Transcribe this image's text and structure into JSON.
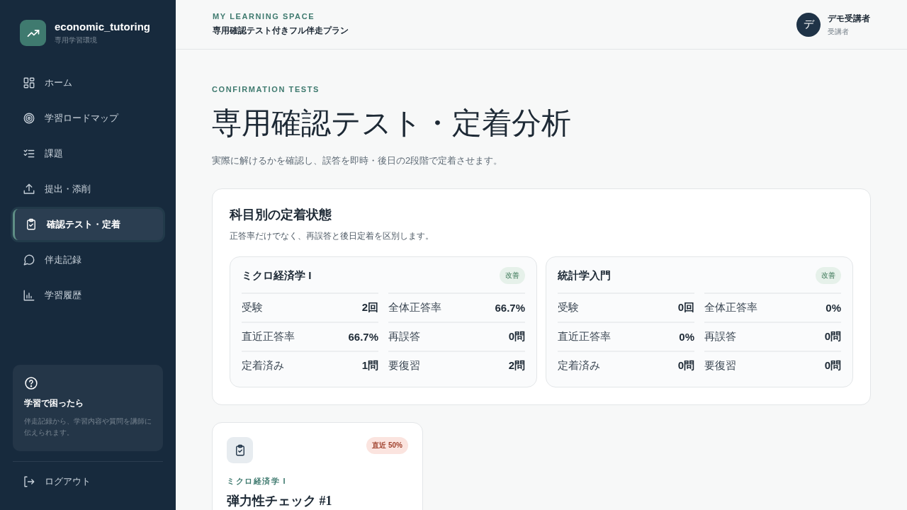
{
  "sidebar": {
    "brand": {
      "name": "economic_tutoring",
      "subtitle": "専用学習環境"
    },
    "items": [
      {
        "label": "ホーム",
        "selected": false
      },
      {
        "label": "学習ロードマップ",
        "selected": false
      },
      {
        "label": "課題",
        "selected": false
      },
      {
        "label": "提出・添削",
        "selected": false
      },
      {
        "label": "確認テスト・定着",
        "selected": true
      },
      {
        "label": "伴走記録",
        "selected": false
      },
      {
        "label": "学習履歴",
        "selected": false
      }
    ],
    "help": {
      "title": "学習で困ったら",
      "text": "伴走記録から、学習内容や質問を講師に伝えられます。"
    },
    "logout": "ログアウト"
  },
  "header": {
    "eyebrow": "MY LEARNING SPACE",
    "plan": "専用確認テスト付きフル伴走プラン",
    "user": {
      "avatar": "デ",
      "name": "デモ受講者",
      "role": "受講者"
    }
  },
  "page": {
    "eyebrow": "CONFIRMATION TESTS",
    "title": "専用確認テスト・定着分析",
    "description": "実際に解けるかを確認し、誤答を即時・後日の2段階で定着させます。"
  },
  "retention": {
    "title": "科目別の定着状態",
    "subtitle": "正答率だけでなく、再誤答と後日定着を区別します。",
    "subjects": [
      {
        "name": "ミクロ経済学 I",
        "badge": "改善",
        "stats": [
          {
            "label": "受験",
            "value": "2回"
          },
          {
            "label": "全体正答率",
            "value": "66.7%"
          },
          {
            "label": "直近正答率",
            "value": "66.7%"
          },
          {
            "label": "再誤答",
            "value": "0問"
          },
          {
            "label": "定着済み",
            "value": "1問"
          },
          {
            "label": "要復習",
            "value": "2問"
          }
        ]
      },
      {
        "name": "統計学入門",
        "badge": "改善",
        "stats": [
          {
            "label": "受験",
            "value": "0回"
          },
          {
            "label": "全体正答率",
            "value": "0%"
          },
          {
            "label": "直近正答率",
            "value": "0%"
          },
          {
            "label": "再誤答",
            "value": "0問"
          },
          {
            "label": "定着済み",
            "value": "0問"
          },
          {
            "label": "要復習",
            "value": "0問"
          }
        ]
      }
    ]
  },
  "tests": [
    {
      "badge": "直近 50%",
      "subject": "ミクロ経済学 I",
      "title": "弾力性チェック #1"
    }
  ]
}
